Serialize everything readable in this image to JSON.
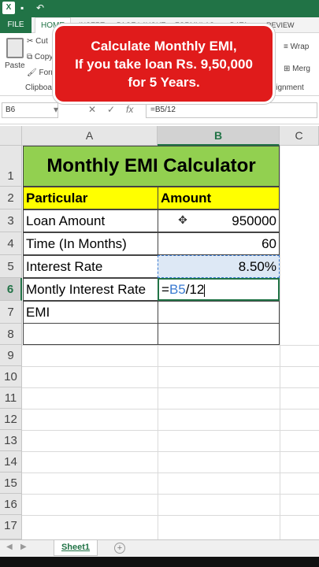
{
  "titlebar": {
    "logo": "X",
    "save_icon": "save-icon",
    "undo_icon": "undo-icon"
  },
  "ribbon_tabs": {
    "file": "FILE",
    "home": "HOME",
    "insert": "INSERT",
    "page_layout": "PAGE LAYOUT",
    "formulas": "FORMULAS",
    "data": "DATA",
    "review": "REVIEW"
  },
  "ribbon": {
    "paste": "Paste",
    "cut": "Cut",
    "copy": "Copy",
    "format": "Form",
    "clipboard": "Clipboard",
    "wrap": "Wrap",
    "merge": "Merg",
    "alignment": "lignment"
  },
  "banner": {
    "line1": "Calculate Monthly EMI,",
    "line2": "If you take loan Rs. 9,50,000",
    "line3": "for 5 Years.",
    "color": "#e01b1b"
  },
  "formula_bar": {
    "name_box": "B6",
    "formula": "=B5/12",
    "cancel": "✕",
    "enter": "✓",
    "fx": "fx"
  },
  "columns": [
    "A",
    "B",
    "C"
  ],
  "rows": [
    "1",
    "2",
    "3",
    "4",
    "5",
    "6",
    "7",
    "8",
    "9",
    "10",
    "11",
    "12",
    "13",
    "14",
    "15",
    "16",
    "17"
  ],
  "sheet": {
    "title": "Monthly EMI Calculator",
    "header_particular": "Particular",
    "header_amount": "Amount",
    "loan_amount_label": "Loan Amount",
    "loan_amount_value": "950000",
    "time_label": "Time (In Months)",
    "time_value": "60",
    "rate_label": "Interest Rate",
    "rate_value": "8.50%",
    "monthly_rate_label": "Montly Interest Rate",
    "monthly_rate_edit_eq": "=",
    "monthly_rate_edit_ref": "B5",
    "monthly_rate_edit_rest": "/12",
    "emi_label": "EMI"
  },
  "sheet_tabs": {
    "active": "Sheet1",
    "add": "+"
  },
  "colors": {
    "excel_green": "#217346",
    "title_fill": "#92d050",
    "header_fill": "#ffff00"
  }
}
